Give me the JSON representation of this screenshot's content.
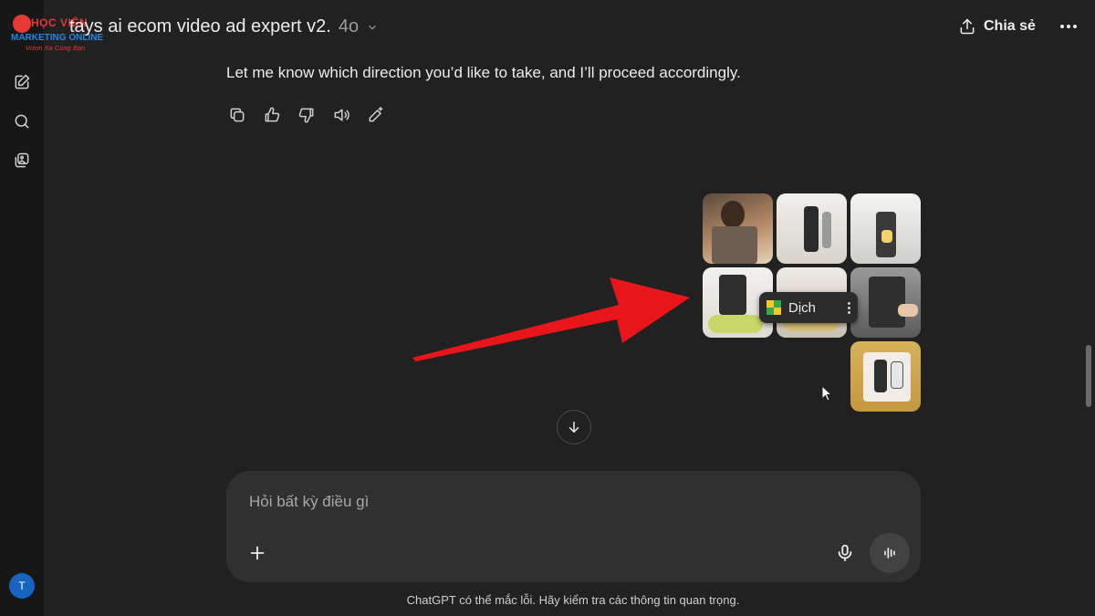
{
  "header": {
    "title": "tays ai ecom video ad expert v2.",
    "model": "4o",
    "share_label": "Chia sẻ"
  },
  "logo": {
    "line1": "HỌC VIỆN",
    "line2": "MARKETING ONLINE",
    "tagline": "Vươn Xa Cùng Bạn"
  },
  "sidebar": {
    "items": [
      {
        "name": "new-chat",
        "icon": "edit-icon"
      },
      {
        "name": "search",
        "icon": "search-icon"
      },
      {
        "name": "library",
        "icon": "gallery-icon"
      }
    ],
    "avatar_initial": "T"
  },
  "message": {
    "text": "Let me know which direction you’d like to take, and I’ll proceed accordingly."
  },
  "translate_popup": {
    "label": "Dịch"
  },
  "composer": {
    "placeholder": "Hỏi bất kỳ điều gì"
  },
  "footer": {
    "note": "ChatGPT có thể mắc lỗi. Hãy kiểm tra các thông tin quan trọng."
  },
  "colors": {
    "background": "#212121",
    "sidebar": "#171717",
    "composer": "#303030",
    "annotation_arrow": "#e8161b",
    "avatar": "#1565c0"
  }
}
